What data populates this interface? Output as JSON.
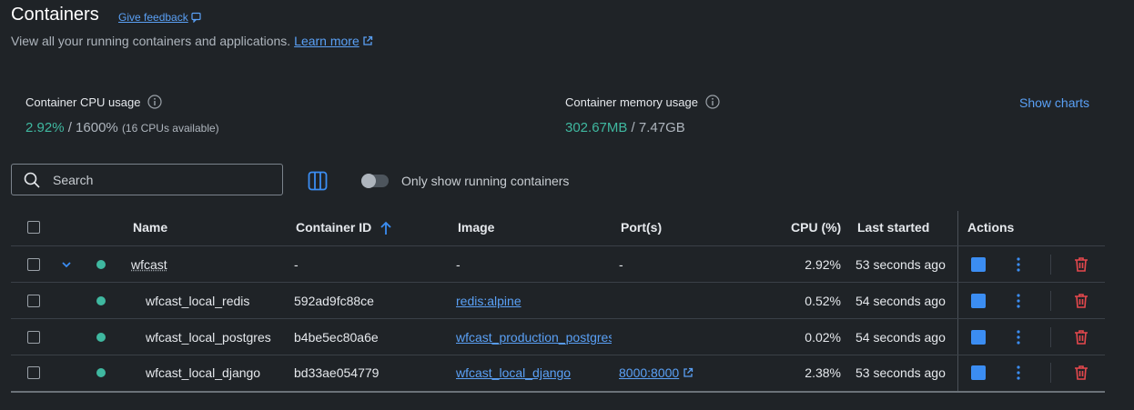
{
  "header": {
    "title": "Containers",
    "feedback_label": "Give feedback",
    "subtitle": "View all your running containers and applications.",
    "learn_more_label": "Learn more"
  },
  "stats": {
    "cpu_label": "Container CPU usage",
    "cpu_used": "2.92%",
    "cpu_total": " / 1600%",
    "cpu_note": "(16 CPUs available)",
    "mem_label": "Container memory usage",
    "mem_used": "302.67MB",
    "mem_total": " / 7.47GB",
    "show_charts_label": "Show charts"
  },
  "toolbar": {
    "search_placeholder": "Search",
    "toggle_label": "Only show running containers",
    "toggle_on": false
  },
  "table": {
    "headers": {
      "name": "Name",
      "container_id": "Container ID",
      "image": "Image",
      "ports": "Port(s)",
      "cpu": "CPU (%)",
      "last_started": "Last started",
      "actions": "Actions"
    },
    "rows": [
      {
        "name": "wfcast",
        "id": "-",
        "image": "-",
        "ports": "-",
        "cpu": "2.92%",
        "last_started": "53 seconds ago",
        "is_group": true
      },
      {
        "name": "wfcast_local_redis",
        "id": "592ad9fc88ce",
        "image": "redis:alpine",
        "ports": "",
        "cpu": "0.52%",
        "last_started": "54 seconds ago"
      },
      {
        "name": "wfcast_local_postgres",
        "id": "b4be5ec80a6e",
        "image": "wfcast_production_postgres",
        "ports": "",
        "cpu": "0.02%",
        "last_started": "54 seconds ago"
      },
      {
        "name": "wfcast_local_django",
        "id": "bd33ae054779",
        "image": "wfcast_local_django",
        "ports": "8000:8000",
        "cpu": "2.38%",
        "last_started": "53 seconds ago"
      }
    ]
  },
  "colors": {
    "accent": "#3b8df2",
    "running": "#3fb8a0",
    "delete": "#e5484d"
  }
}
